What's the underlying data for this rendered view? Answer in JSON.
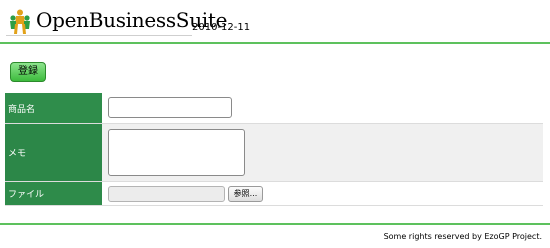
{
  "header": {
    "logo_text": "OpenBusinessSuite",
    "date": "2010-12-11"
  },
  "toolbar": {
    "register_label": "登録"
  },
  "form": {
    "fields": [
      {
        "label": "商品名",
        "value": ""
      },
      {
        "label": "メモ",
        "value": ""
      },
      {
        "label": "ファイル",
        "value": ""
      }
    ],
    "browse_label": "参照..."
  },
  "footer": {
    "text": "Some rights reserved by EzoGP Project."
  },
  "colors": {
    "accent": "#5dc15d",
    "label_bg": "#2e8b4a",
    "button_bg": "#3dbb3d"
  }
}
